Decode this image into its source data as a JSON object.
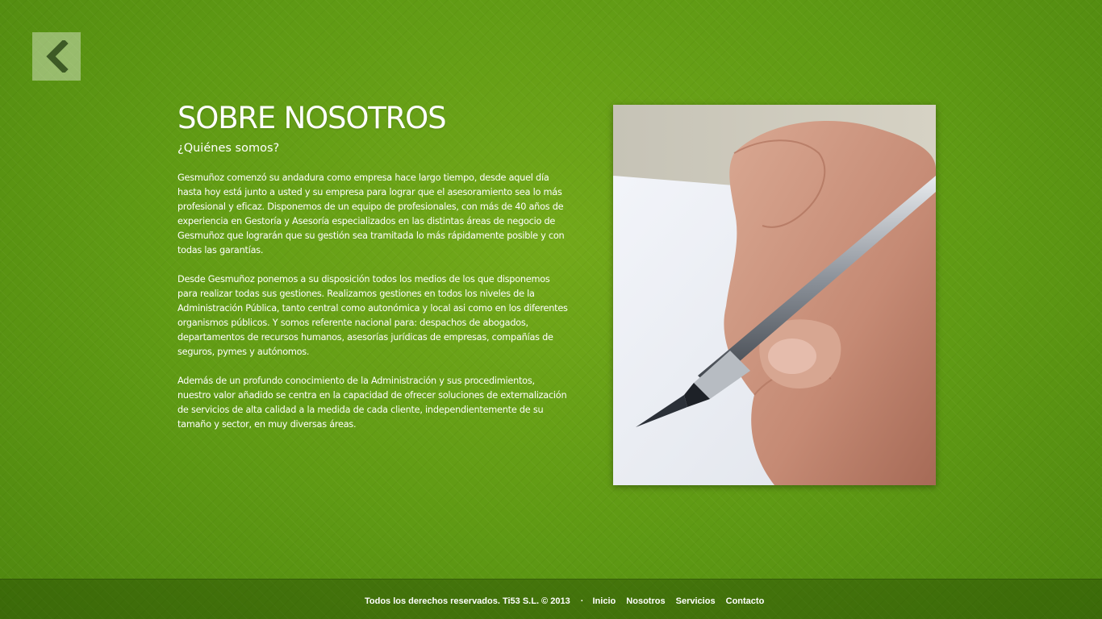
{
  "nav": {
    "back_icon": "chevron-left-icon"
  },
  "main": {
    "title": "SOBRE NOSOTROS",
    "subtitle": "¿Quiénes somos?",
    "paragraphs": [
      "Gesmuñoz comenzó su andadura como empresa hace largo tiempo, desde aquel día hasta hoy está junto a usted y su empresa para lograr que el asesoramiento sea lo más profesional y eficaz. Disponemos de un equipo de profesionales, con más de 40 años de experiencia en Gestoría y Asesoría especializados en las distintas áreas de negocio de Gesmuñoz que lograrán que su gestión sea tramitada lo más rápidamente posible y con todas las garantías.",
      "Desde Gesmuñoz ponemos a su disposición todos los medios de los que disponemos para realizar todas sus gestiones. Realizamos gestiones en todos los niveles de la Administración Pública, tanto central como autonómica y local asi como en los diferentes organismos públicos. Y somos referente nacional para: despachos de abogados, departamentos de recursos humanos, asesorías jurídicas de empresas, compañías de seguros, pymes y autónomos.",
      "Además de un profundo conocimiento de la Administración y sus procedimientos, nuestro valor añadido se centra en la capacidad de ofrecer soluciones de externalización de servicios de alta calidad a la medida de cada cliente, independientemente de su tamaño y sector, en muy diversas áreas."
    ]
  },
  "footer": {
    "copyright": "Todos los derechos reservados. Ti53 S.L. © 2013",
    "separator": "·",
    "links": [
      "Inicio",
      "Nosotros",
      "Servicios",
      "Contacto"
    ]
  },
  "colors": {
    "background": "#5e9914",
    "text": "#ffffff"
  }
}
